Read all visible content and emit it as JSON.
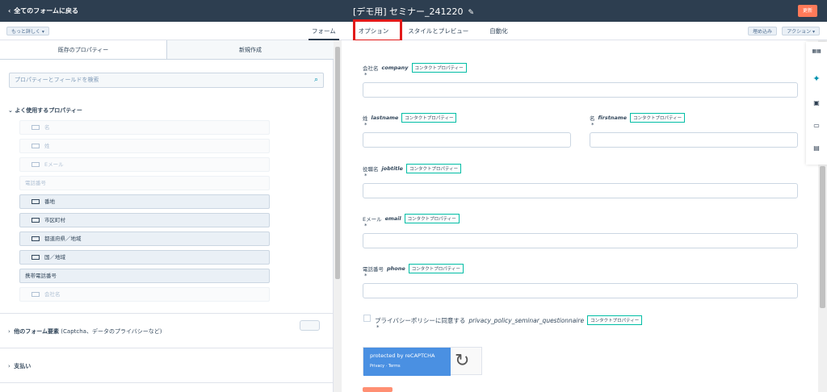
{
  "topbar": {
    "back_label": "全てのフォームに戻る",
    "title": "[デモ用] セミナー_241220",
    "update_label": "更新"
  },
  "subbar": {
    "more_label": "もっと詳しく ▾",
    "tabs": [
      {
        "label": "フォーム",
        "active": true
      },
      {
        "label": "オプション",
        "active": false
      },
      {
        "label": "スタイルとプレビュー",
        "active": false
      },
      {
        "label": "自動化",
        "active": false
      }
    ],
    "embed_label": "埋め込み",
    "action_label": "アクション ▾"
  },
  "left": {
    "tabs": [
      {
        "label": "既存のプロパティー",
        "active": true
      },
      {
        "label": "新規作成",
        "active": false
      }
    ],
    "search_placeholder": "プロパティーとフィールドを検索",
    "frequent_title": "よく使用するプロパティー",
    "fields": [
      {
        "label": "名",
        "state": "disabled",
        "icon": true
      },
      {
        "label": "姓",
        "state": "disabled",
        "icon": true
      },
      {
        "label": "Eメール",
        "state": "disabled",
        "icon": true
      },
      {
        "label": "電話番号",
        "state": "disabled",
        "icon": false
      },
      {
        "label": "番地",
        "state": "enabled",
        "icon": true
      },
      {
        "label": "市区町村",
        "state": "enabled",
        "icon": true
      },
      {
        "label": "都道府県／地域",
        "state": "enabled",
        "icon": true
      },
      {
        "label": "国／地域",
        "state": "enabled",
        "icon": true
      },
      {
        "label": "携帯電話番号",
        "state": "enabled",
        "icon": false
      },
      {
        "label": "会社名",
        "state": "disabled",
        "icon": true
      }
    ],
    "other_title": "他のフォーム要素",
    "other_suffix": "(Captcha、データのプライバシーなど)",
    "payment_title": "支払い"
  },
  "form": {
    "badge": "コンタクトプロパティー",
    "required_mark": "*",
    "company": {
      "label": "会社名",
      "internal": "company"
    },
    "lastname": {
      "label": "姓",
      "internal": "lastname"
    },
    "firstname": {
      "label": "名",
      "internal": "firstname"
    },
    "jobtitle": {
      "label": "役職名",
      "internal": "jobtitle"
    },
    "email": {
      "label": "Eメール",
      "internal": "email"
    },
    "phone": {
      "label": "電話番号",
      "internal": "phone"
    },
    "privacy": {
      "label": "プライバシーポリシーに同意する",
      "internal": "privacy_policy_seminar_questionnaire"
    },
    "captcha": {
      "line1": "protected by reCAPTCHA",
      "line2": "Privacy · Terms"
    }
  },
  "rail_icons": [
    "grid-icon",
    "sparkle-icon",
    "chat-icon",
    "calendar-icon",
    "calendar-check-icon"
  ]
}
